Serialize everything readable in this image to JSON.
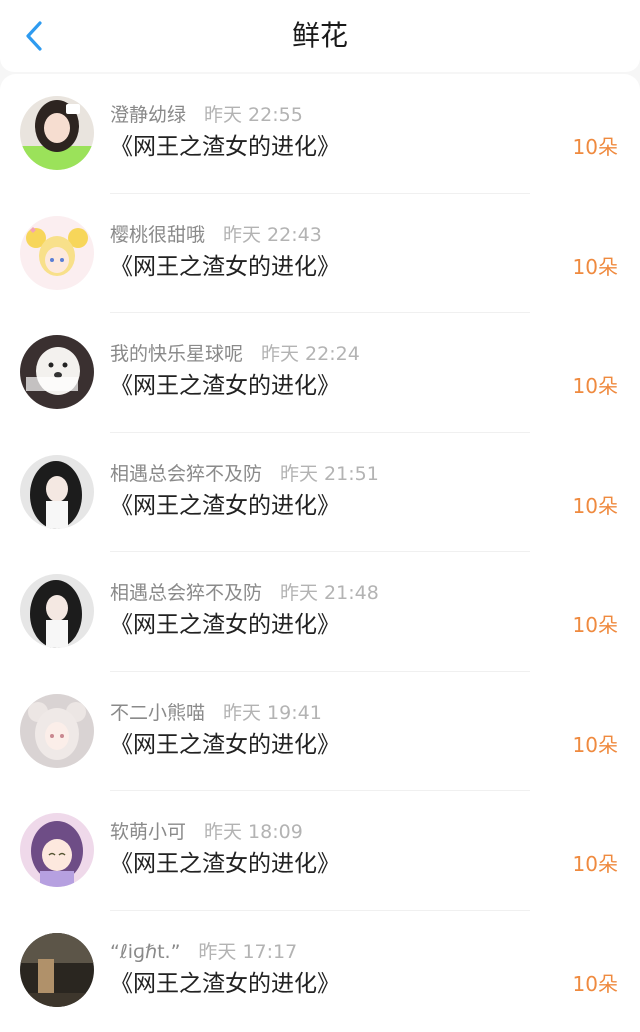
{
  "header": {
    "title": "鲜花",
    "back_icon": "chevron-left-icon",
    "accent_color": "#2e9bf0"
  },
  "colors": {
    "count": "#ef8a3f",
    "username": "#8a8a8a",
    "time": "#b3b3b3"
  },
  "items": [
    {
      "username": "澄静幼绿",
      "time": "昨天 22:55",
      "book": "《网王之渣女的进化》",
      "count": "10朵"
    },
    {
      "username": "樱桃很甜哦",
      "time": "昨天 22:43",
      "book": "《网王之渣女的进化》",
      "count": "10朵"
    },
    {
      "username": "我的快乐星球呢",
      "time": "昨天 22:24",
      "book": "《网王之渣女的进化》",
      "count": "10朵"
    },
    {
      "username": "相遇总会猝不及防",
      "time": "昨天 21:51",
      "book": "《网王之渣女的进化》",
      "count": "10朵"
    },
    {
      "username": "相遇总会猝不及防",
      "time": "昨天 21:48",
      "book": "《网王之渣女的进化》",
      "count": "10朵"
    },
    {
      "username": "不二小熊喵",
      "time": "昨天 19:41",
      "book": "《网王之渣女的进化》",
      "count": "10朵"
    },
    {
      "username": "软萌小可",
      "time": "昨天 18:09",
      "book": "《网王之渣女的进化》",
      "count": "10朵"
    },
    {
      "username": "“ℓiɡℏt.”",
      "time": "昨天 17:17",
      "book": "《网王之渣女的进化》",
      "count": "10朵"
    }
  ]
}
